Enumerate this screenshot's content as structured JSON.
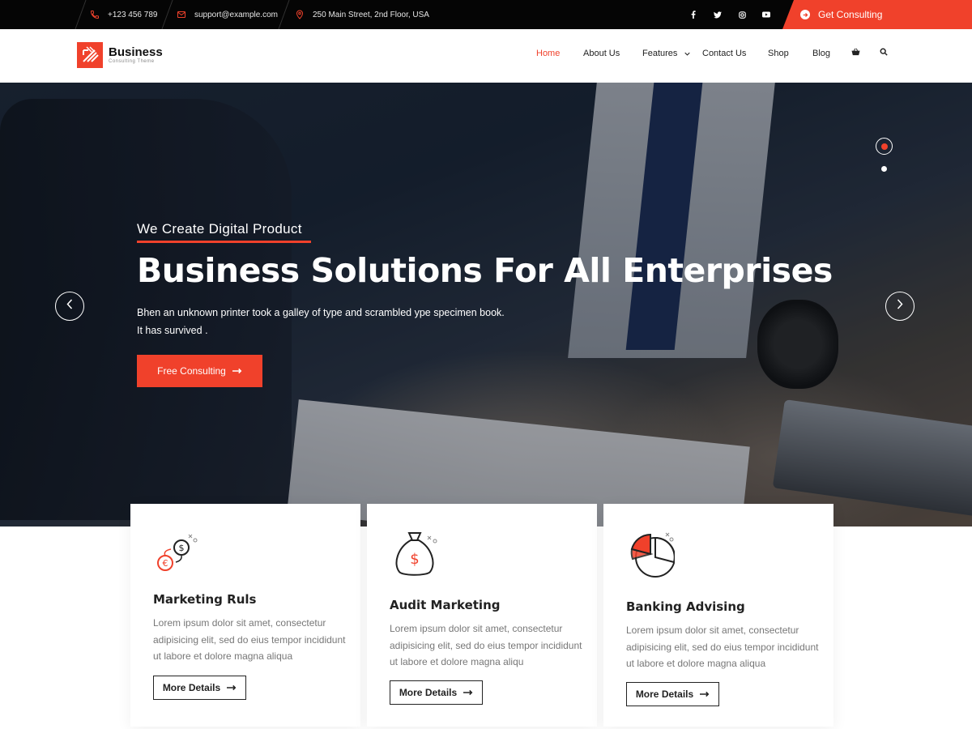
{
  "topbar": {
    "phone": "+123 456 789",
    "email": "support@example.com",
    "address": "250 Main Street, 2nd Floor, USA",
    "social": [
      "facebook",
      "twitter",
      "instagram",
      "youtube"
    ],
    "cta_label": "Get Consulting"
  },
  "logo": {
    "name": "Business",
    "tagline": "Consulting Theme"
  },
  "nav": {
    "items": [
      {
        "label": "Home"
      },
      {
        "label": "About Us"
      },
      {
        "label": "Features"
      },
      {
        "label": "Contact Us"
      },
      {
        "label": "Shop"
      },
      {
        "label": "Blog"
      }
    ]
  },
  "hero": {
    "subtitle": "We Create Digital Product",
    "title": "Business Solutions For All Enterprises",
    "description_line1": "Bhen an unknown printer took a galley of type and scrambled ype specimen book.",
    "description_line2": "It has survived .",
    "button_label": "Free Consulting"
  },
  "services": [
    {
      "title": "Marketing Ruls",
      "text": "Lorem ipsum dolor sit amet, consectetur adipisicing elit, sed do eius tempor incididunt ut labore et dolore magna aliqua",
      "button": "More Details",
      "icon": "currency-exchange-icon"
    },
    {
      "title": "Audit Marketing",
      "text": "Lorem ipsum dolor sit amet, consectetur adipisicing elit, sed do eius tempor incididunt ut labore et dolore magna aliqu",
      "button": "More Details",
      "icon": "money-bag-icon"
    },
    {
      "title": "Banking Advising",
      "text": "Lorem ipsum dolor sit amet, consectetur adipisicing elit, sed do eius tempor incididunt ut labore et dolore magna aliqua",
      "button": "More Details",
      "icon": "pie-chart-icon"
    }
  ],
  "colors": {
    "accent": "#f0412b",
    "topbar_bg": "#050505",
    "text_dark": "#222222",
    "text_muted": "#777777"
  }
}
